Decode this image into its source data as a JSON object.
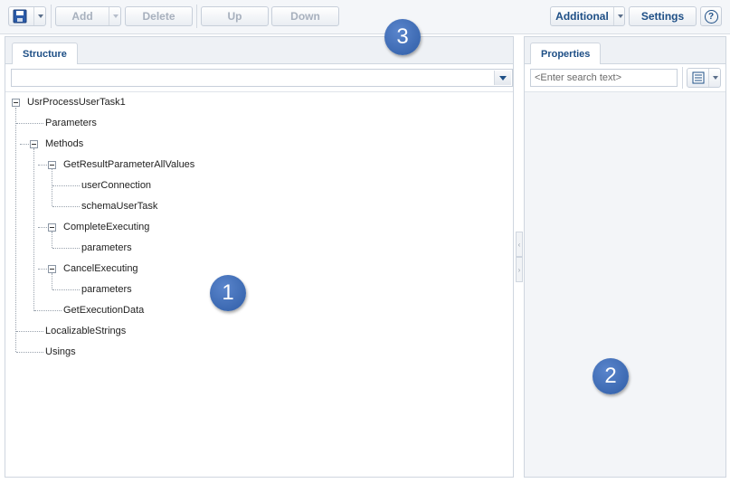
{
  "toolbar": {
    "add_label": "Add",
    "delete_label": "Delete",
    "up_label": "Up",
    "down_label": "Down",
    "additional_label": "Additional",
    "settings_label": "Settings",
    "help_icon": "?"
  },
  "structure_panel": {
    "tab_label": "Structure",
    "tree": [
      {
        "label": "UsrProcessUserTask1"
      },
      {
        "label": "Parameters"
      },
      {
        "label": "Methods"
      },
      {
        "label": "GetResultParameterAllValues"
      },
      {
        "label": "userConnection"
      },
      {
        "label": "schemaUserTask"
      },
      {
        "label": "CompleteExecuting"
      },
      {
        "label": "parameters"
      },
      {
        "label": "CancelExecuting"
      },
      {
        "label": "parameters"
      },
      {
        "label": "GetExecutionData"
      },
      {
        "label": "LocalizableStrings"
      },
      {
        "label": "Usings"
      }
    ]
  },
  "properties_panel": {
    "tab_label": "Properties",
    "search_placeholder": "<Enter search text>"
  },
  "markers": {
    "m1": "1",
    "m2": "2",
    "m3": "3"
  },
  "colors": {
    "accent": "#1e4f86",
    "marker": "#3a68b4",
    "disabled_text": "#a7b0bd"
  },
  "icons": [
    "save-icon",
    "dropdown-arrow-icon",
    "help-icon",
    "tree-expander-icon",
    "property-view-icon"
  ]
}
